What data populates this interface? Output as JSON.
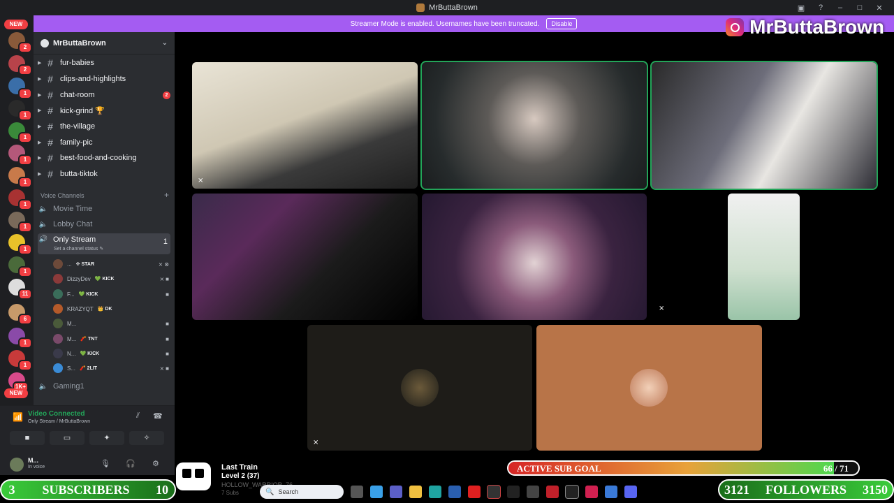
{
  "window": {
    "title": "MrButtaBrown"
  },
  "banner": {
    "text": "Streamer Mode is enabled. Usernames have been truncated.",
    "button": "Disable"
  },
  "overlay": {
    "ig_handle": "MrButtaBrown",
    "subscribers": {
      "current": "3",
      "label": "SUBSCRIBERS",
      "goal": "10"
    },
    "followers": {
      "current": "3121",
      "label": "FOLLOWERS",
      "goal": "3150"
    },
    "sub_goal": {
      "label": "ACTIVE SUB GOAL",
      "value": "66 / 71",
      "fraction": 0.93
    },
    "train": {
      "title": "Last Train",
      "level": "Level 2 (37)",
      "line3": "HOLLOW_WARRIOR_76",
      "line4": "7 Subs"
    }
  },
  "rail": {
    "new_top": "NEW",
    "new_bottom": "NEW",
    "badges": [
      "2",
      "2",
      "1",
      "1",
      "1",
      "1",
      "1",
      "1",
      "1",
      "1",
      "1",
      "11",
      "6",
      "1",
      "1",
      "1K+"
    ]
  },
  "guild": {
    "name": "MrButtaBrown"
  },
  "channels": [
    {
      "name": "fur-babies",
      "badge": ""
    },
    {
      "name": "clips-and-highlights",
      "badge": ""
    },
    {
      "name": "chat-room",
      "badge": "2"
    },
    {
      "name": "kick-grind 🏆",
      "badge": ""
    },
    {
      "name": "the-village",
      "badge": ""
    },
    {
      "name": "family-pic",
      "badge": ""
    },
    {
      "name": "best-food-and-cooking",
      "badge": ""
    },
    {
      "name": "butta-tiktok",
      "badge": ""
    }
  ],
  "voice": {
    "category": "Voice Channels",
    "channels": [
      {
        "name": "Movie Time",
        "badge": ""
      },
      {
        "name": "Lobby Chat",
        "badge": ""
      },
      {
        "name": "Only Stream",
        "badge": "1",
        "status": "Set a channel status ✎"
      },
      {
        "name": "Gaming",
        "badge": "1"
      }
    ],
    "users": [
      {
        "name": "...",
        "tag": "✜ STAR",
        "color": "#6d4a3a"
      },
      {
        "name": "DizzyDev",
        "tag": "💚 KICK",
        "color": "#8b3a3a"
      },
      {
        "name": "F...",
        "tag": "💚 KICK",
        "color": "#3a6d5a"
      },
      {
        "name": "KRAZYQT",
        "tag": "👑 DK",
        "color": "#b45a2a"
      },
      {
        "name": "M...",
        "tag": "",
        "color": "#4a5a3a"
      },
      {
        "name": "M...",
        "tag": "🧨 TNT",
        "color": "#7a4a6a"
      },
      {
        "name": "N...",
        "tag": "💚 KICK",
        "color": "#3a3a4a"
      },
      {
        "name": "S...",
        "tag": "🧨 2LIT",
        "color": "#3a8bd6"
      }
    ]
  },
  "voice_panel": {
    "title": "Video Connected",
    "subtitle": "Only Stream / MrButtaBrown"
  },
  "user": {
    "name": "M...",
    "status": "In voice"
  },
  "taskbar": {
    "search": "Search"
  },
  "colors": {
    "accent": "#a45cf2",
    "online": "#23a559",
    "badge": "#f23f43"
  }
}
